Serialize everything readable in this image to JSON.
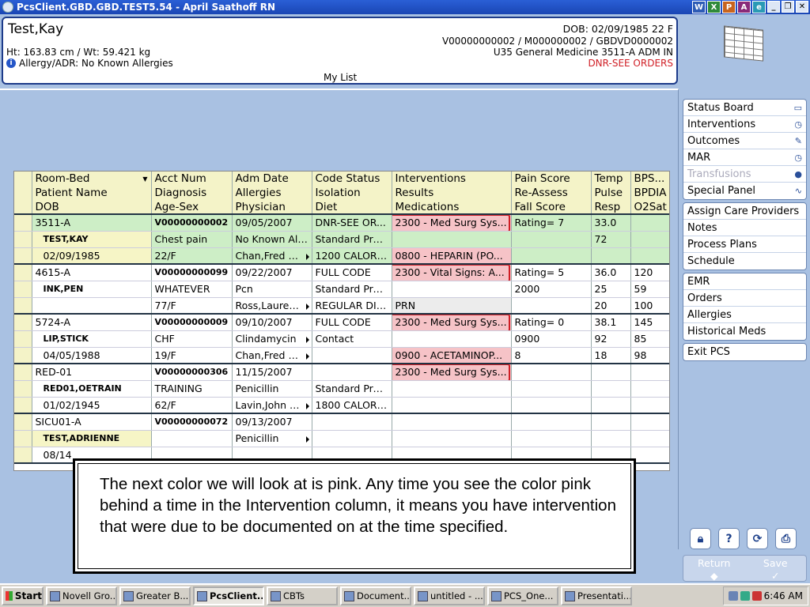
{
  "window": {
    "title": "PcsClient.GBD.GBD.TEST5.54 - April Saathoff RN"
  },
  "patient": {
    "name": "Test,Kay",
    "dob_line": "DOB: 02/09/1985 22 F",
    "ids": "V00000000002 / M000000002 / GBDVD0000002",
    "location": "U35 General Medicine  3511-A  ADM IN",
    "code": "DNR-SEE ORDERS",
    "ht_wt": "Ht: 163.83 cm / Wt: 59.421 kg",
    "allergy": "Allergy/ADR: No Known Allergies",
    "list_name": "My List"
  },
  "grid": {
    "headers": [
      [
        "Room-Bed",
        "Acct Num",
        "Adm Date",
        "Code Status",
        "Interventions",
        "Pain Score",
        "Temp",
        "BPS..."
      ],
      [
        "Patient Name",
        "Diagnosis",
        "Allergies",
        "Isolation",
        "Results",
        "Re-Assess",
        "Pulse",
        "BPDIA"
      ],
      [
        "DOB",
        "Age-Sex",
        "Physician",
        "Diet",
        "Medications",
        "Fall Score",
        "Resp",
        "O2Sat"
      ]
    ],
    "patients": [
      {
        "rows": [
          [
            "3511-A",
            "V00000000002",
            "09/05/2007",
            "DNR-SEE OR...",
            "2300 - Med Surg Sys...",
            "Rating= 7",
            "33.0",
            ""
          ],
          [
            "TEST,KAY",
            "Chest pain",
            "No Known All...",
            "Standard Pre...",
            "",
            "",
            "72",
            ""
          ],
          [
            "02/09/1985",
            "22/F",
            "Chan,Fred T ...",
            "1200 CALORI...",
            "0800 - HEPARIN (PO...",
            "",
            "",
            ""
          ]
        ]
      },
      {
        "rows": [
          [
            "4615-A",
            "V00000000099",
            "09/22/2007",
            "FULL CODE",
            "2300 - Vital Signs: A...",
            "Rating= 5",
            "36.0",
            "120"
          ],
          [
            "INK,PEN",
            "WHATEVER",
            "Pcn",
            "Standard Pre...",
            "",
            "2000",
            "25",
            "59"
          ],
          [
            "",
            "77/F",
            "Ross,Laurenc...",
            "REGULAR DIET",
            "PRN",
            "",
            "20",
            "100"
          ]
        ]
      },
      {
        "rows": [
          [
            "5724-A",
            "V00000000009",
            "09/10/2007",
            "FULL CODE",
            "2300 - Med Surg Sys...",
            "Rating= 0",
            "38.1",
            "145"
          ],
          [
            "LIP,STICK",
            "CHF",
            "Clindamycin",
            "Contact",
            "",
            "0900",
            "92",
            "85"
          ],
          [
            "04/05/1988",
            "19/F",
            "Chan,Fred T ...",
            "",
            "0900 - ACETAMINOP...",
            "8",
            "18",
            "98"
          ]
        ]
      },
      {
        "rows": [
          [
            "RED-01",
            "V00000000306",
            "11/15/2007",
            "",
            "2300 - Med Surg Sys...",
            "",
            "",
            ""
          ],
          [
            "RED01,OETRAIN",
            "TRAINING",
            "Penicillin",
            "Standard Pre...",
            "",
            "",
            "",
            ""
          ],
          [
            "01/02/1945",
            "62/F",
            "Lavin,John G ...",
            "1800 CALORI...",
            "",
            "",
            "",
            ""
          ]
        ]
      },
      {
        "rows": [
          [
            "SICU01-A",
            "V00000000072",
            "09/13/2007",
            "",
            "",
            "",
            "",
            ""
          ],
          [
            "TEST,ADRIENNE",
            "",
            "Penicillin",
            "",
            "",
            "",
            "",
            ""
          ],
          [
            "08/14",
            "",
            "",
            "",
            "",
            "",
            "",
            ""
          ]
        ]
      }
    ]
  },
  "callout": {
    "text": "The next color we will look at is pink. Any time you see the color pink behind a time in the Intervention column, it means you have intervention that were due to be documented on at the time specified."
  },
  "side_panel": {
    "group1": [
      {
        "label": "Status Board",
        "icon": "board-icon"
      },
      {
        "label": "Interventions",
        "icon": "clock-icon"
      },
      {
        "label": "Outcomes",
        "icon": "pencil-icon"
      },
      {
        "label": "MAR",
        "icon": "clock-icon"
      },
      {
        "label": "Transfusions",
        "icon": "drop-icon",
        "disabled": true
      },
      {
        "label": "Special Panel",
        "icon": "pulse-icon"
      }
    ],
    "group2": [
      "Assign Care Providers",
      "Notes",
      "Process Plans",
      "Schedule"
    ],
    "group3": [
      "EMR",
      "Orders",
      "Allergies",
      "Historical Meds"
    ],
    "group4": [
      "Exit PCS"
    ],
    "return_label": "Return",
    "save_label": "Save"
  },
  "taskbar": {
    "start": "Start",
    "tasks": [
      "Novell Gro...",
      "Greater B...",
      "PcsClient...",
      "CBTs",
      "Document...",
      "untitled - ...",
      "PCS_One...",
      "Presentati..."
    ],
    "active_index": 2,
    "time": "6:46 AM"
  },
  "colors": {
    "pink": "#f6c3c7",
    "green": "#cdeec6",
    "yellow": "#f4f3c8",
    "alert_red": "#d01e25"
  }
}
